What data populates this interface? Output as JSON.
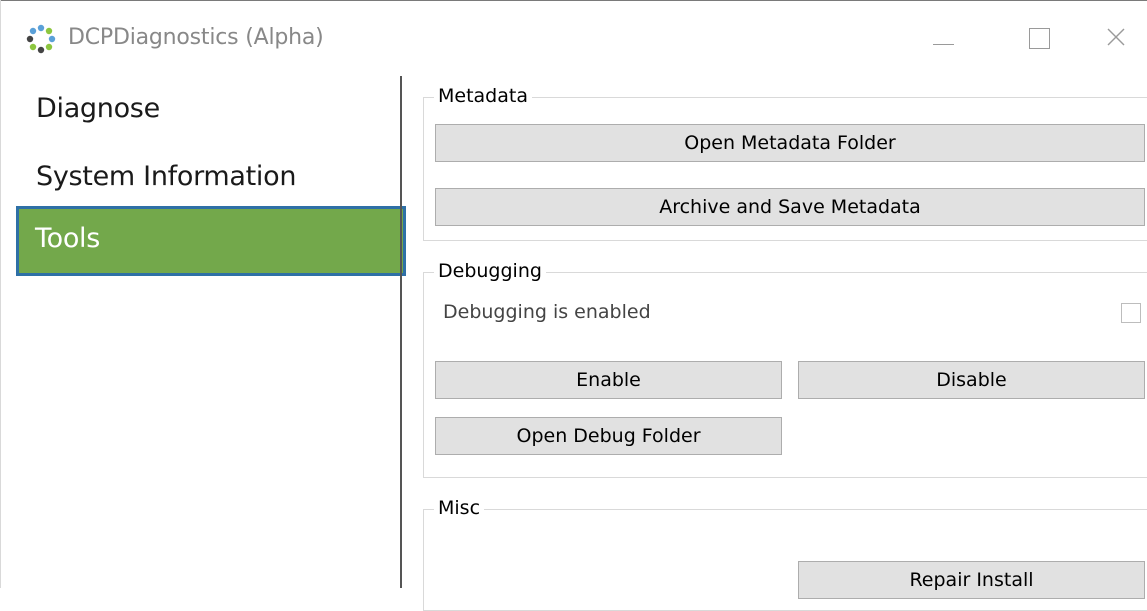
{
  "window": {
    "title": "DCPDiagnostics (Alpha)",
    "app_icon": "dotted-ring-logo-icon",
    "controls": [
      "minimize-icon",
      "maximize-icon",
      "close-icon"
    ]
  },
  "sidebar": {
    "items": [
      {
        "label": "Diagnose",
        "selected": false
      },
      {
        "label": "System Information",
        "selected": false
      },
      {
        "label": "Tools",
        "selected": true
      }
    ]
  },
  "metadata_group": {
    "title": "Metadata",
    "open_folder_label": "Open Metadata Folder",
    "archive_label": "Archive and Save Metadata"
  },
  "debugging_group": {
    "title": "Debugging",
    "status_text": "Debugging is enabled",
    "checkbox_checked": false,
    "enable_label": "Enable",
    "disable_label": "Disable",
    "open_folder_label": "Open Debug Folder"
  },
  "misc_group": {
    "title": "Misc",
    "repair_label": "Repair Install"
  },
  "colors": {
    "selected_nav_bg": "#73a84b",
    "selected_nav_border": "#2e70a6",
    "button_bg": "#e1e1e1"
  }
}
